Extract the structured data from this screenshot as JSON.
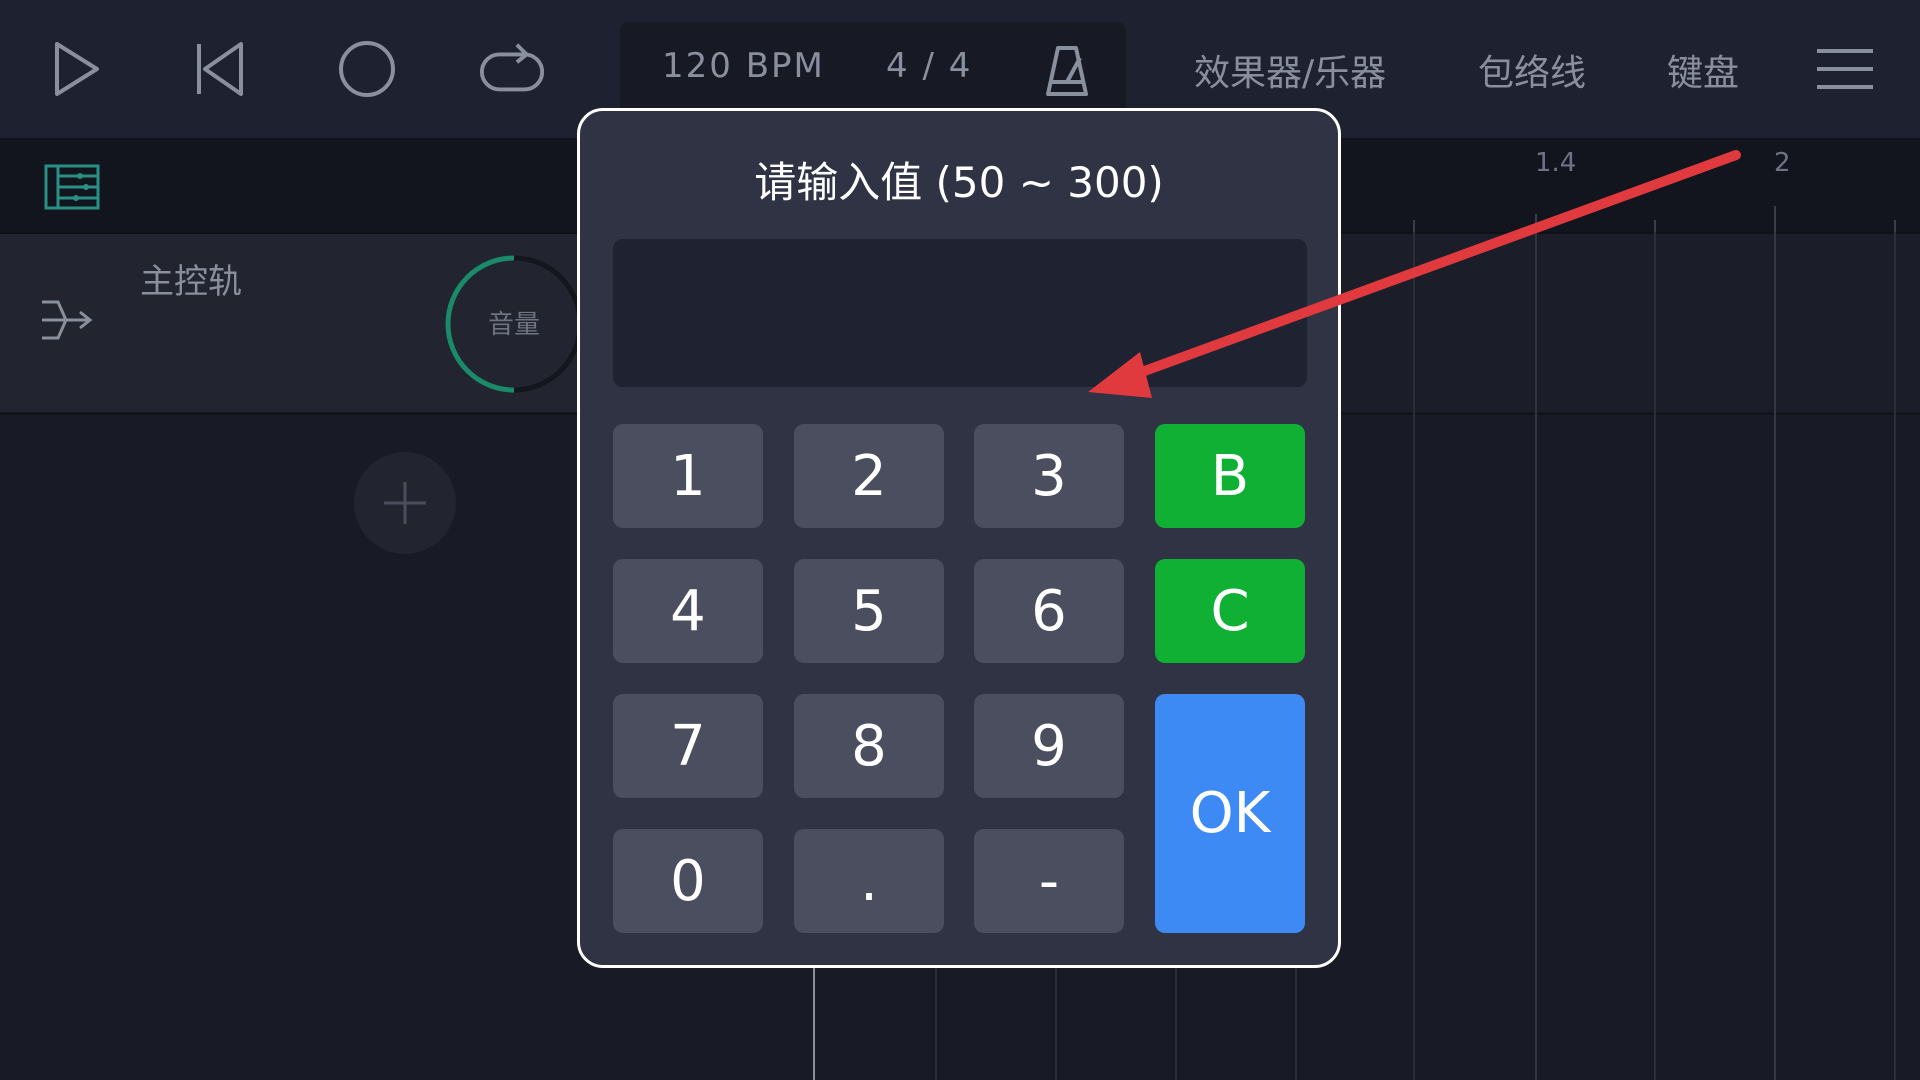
{
  "toolbar": {
    "icons": [
      "play-icon",
      "skip-to-start-icon",
      "record-icon",
      "loop-icon",
      "metronome-icon",
      "menu-icon"
    ],
    "tempo": "120 BPM",
    "time_signature": "4 / 4",
    "menu": [
      "效果器/乐器",
      "包络线",
      "键盘"
    ]
  },
  "ruler": {
    "labels": [
      "1.4",
      "2"
    ]
  },
  "track": {
    "name": "主控轨",
    "knob_label": "音量"
  },
  "dialog": {
    "title": "请输入值 (50 ~ 300)",
    "value": "",
    "keys": [
      "1",
      "2",
      "3",
      "B",
      "4",
      "5",
      "6",
      "C",
      "7",
      "8",
      "9",
      "OK",
      "0",
      ".",
      "-"
    ]
  },
  "colors": {
    "accent_green": "#0fb034",
    "accent_blue": "#3d8af5",
    "annotation_arrow": "#e0393e",
    "knob_ring": "#1a8a6a"
  }
}
